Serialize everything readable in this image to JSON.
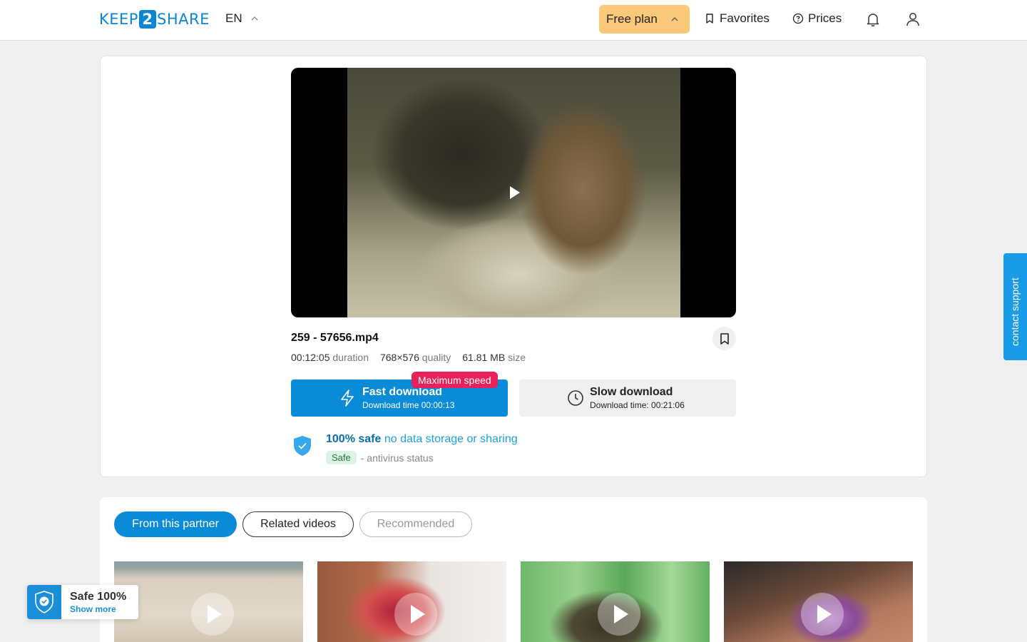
{
  "header": {
    "logo_left": "KEEP",
    "logo_mid": "2",
    "logo_right": "SHARE",
    "language": "EN",
    "plan_label": "Free plan",
    "favorites_label": "Favorites",
    "prices_label": "Prices"
  },
  "file": {
    "name": "259 - 57656.mp4",
    "duration_value": "00:12:05",
    "duration_label": "duration",
    "quality_value": "768×576",
    "quality_label": "quality",
    "size_value": "61.81 MB",
    "size_label": "size"
  },
  "download": {
    "fast_title": "Fast download",
    "fast_time": "Download time 00:00:13",
    "speed_badge": "Maximum speed",
    "slow_title": "Slow download",
    "slow_time": "Download time: 00:21:06"
  },
  "safety": {
    "strong": "100% safe",
    "light": "no data storage or sharing",
    "tag": "Safe",
    "status_text": "- antivirus status"
  },
  "support_tab": "contact support",
  "tabs": [
    {
      "label": "From this partner",
      "state": "active"
    },
    {
      "label": "Related videos",
      "state": "default"
    },
    {
      "label": "Recommended",
      "state": "disabled"
    }
  ],
  "safe_widget": {
    "title": "Safe 100%",
    "link": "Show more"
  },
  "colors": {
    "brand": "#0a86d4",
    "primary_button": "#0a8bd8",
    "plan_badge": "#fbc97a",
    "speed_badge": "#e8215a",
    "safe_tag_bg": "#ddf3e4"
  }
}
